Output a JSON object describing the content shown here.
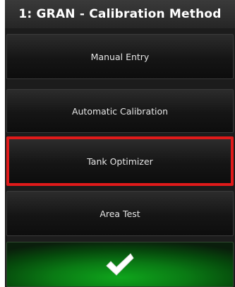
{
  "header": {
    "title": "1: GRAN - Calibration Method"
  },
  "options": [
    {
      "label": "Manual Entry",
      "selected": false
    },
    {
      "label": "Automatic Calibration",
      "selected": false
    },
    {
      "label": "Tank Optimizer",
      "selected": true
    },
    {
      "label": "Area Test",
      "selected": false
    }
  ],
  "confirm_button": {
    "icon": "checkmark-icon"
  },
  "colors": {
    "selection_border": "#e01a1a",
    "confirm_green": "#0fa51c",
    "background": "#1c1c1c",
    "text": "#ffffff"
  }
}
